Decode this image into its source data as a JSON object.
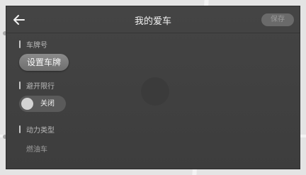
{
  "header": {
    "title": "我的爱车",
    "save_label": "保存"
  },
  "sections": {
    "plate": {
      "label": "车牌号",
      "button_label": "设置车牌"
    },
    "restriction": {
      "label": "避开限行",
      "toggle_label": "关闭",
      "enabled": false
    },
    "power": {
      "label": "动力类型",
      "value": "燃油车"
    }
  }
}
